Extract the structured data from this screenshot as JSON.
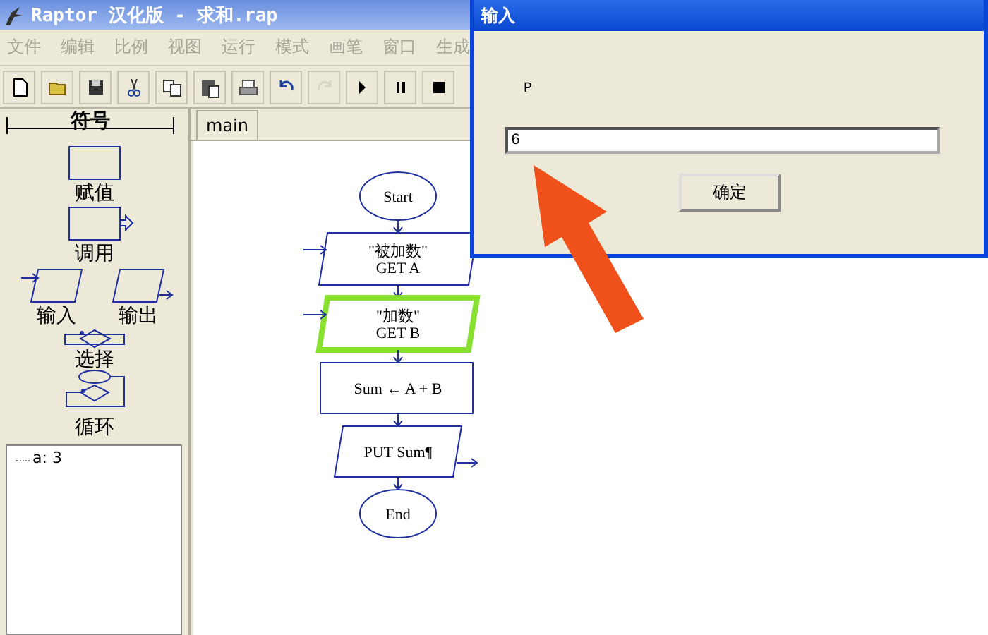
{
  "window": {
    "title": "Raptor 汉化版 - 求和.rap"
  },
  "menu": [
    "文件",
    "编辑",
    "比例",
    "视图",
    "运行",
    "模式",
    "画笔",
    "窗口",
    "生成"
  ],
  "toolbar": [
    {
      "kind": "new",
      "disabled": false
    },
    {
      "kind": "open",
      "disabled": false
    },
    {
      "kind": "save",
      "disabled": false
    },
    {
      "kind": "cut",
      "disabled": false
    },
    {
      "kind": "copy",
      "disabled": false
    },
    {
      "kind": "paste",
      "disabled": false
    },
    {
      "kind": "print",
      "disabled": false
    },
    {
      "kind": "undo",
      "disabled": false
    },
    {
      "kind": "redo",
      "disabled": true
    },
    {
      "kind": "run",
      "disabled": false
    },
    {
      "kind": "pause",
      "disabled": false
    },
    {
      "kind": "stop",
      "disabled": false
    }
  ],
  "symbols": {
    "title": "符号",
    "items": [
      {
        "kind": "assignment",
        "label": "赋值"
      },
      {
        "kind": "call",
        "label": "调用"
      },
      {
        "kind": "input",
        "label": "输入"
      },
      {
        "kind": "output",
        "label": "输出"
      },
      {
        "kind": "selection",
        "label": "选择"
      },
      {
        "kind": "loop",
        "label": "循环"
      }
    ]
  },
  "variables": [
    "a: 3"
  ],
  "tabs": [
    {
      "label": "main",
      "selected": true
    }
  ],
  "flowchart": {
    "nodes": [
      {
        "kind": "start",
        "lines": [
          "Start"
        ],
        "selected": false
      },
      {
        "kind": "input",
        "lines": [
          "\"被加数\"",
          "GET A"
        ],
        "selected": false
      },
      {
        "kind": "input",
        "lines": [
          "\"加数\"",
          "GET B"
        ],
        "selected": true
      },
      {
        "kind": "assignment",
        "lines": [
          "Sum ← A + B"
        ],
        "selected": false
      },
      {
        "kind": "output",
        "lines": [
          "PUT Sum¶"
        ],
        "selected": false
      },
      {
        "kind": "end",
        "lines": [
          "End"
        ],
        "selected": false
      }
    ]
  },
  "dialog": {
    "title": "输入",
    "prompt": "P",
    "value": "6",
    "button": "确定"
  },
  "annotation": {
    "kind": "arrow"
  }
}
